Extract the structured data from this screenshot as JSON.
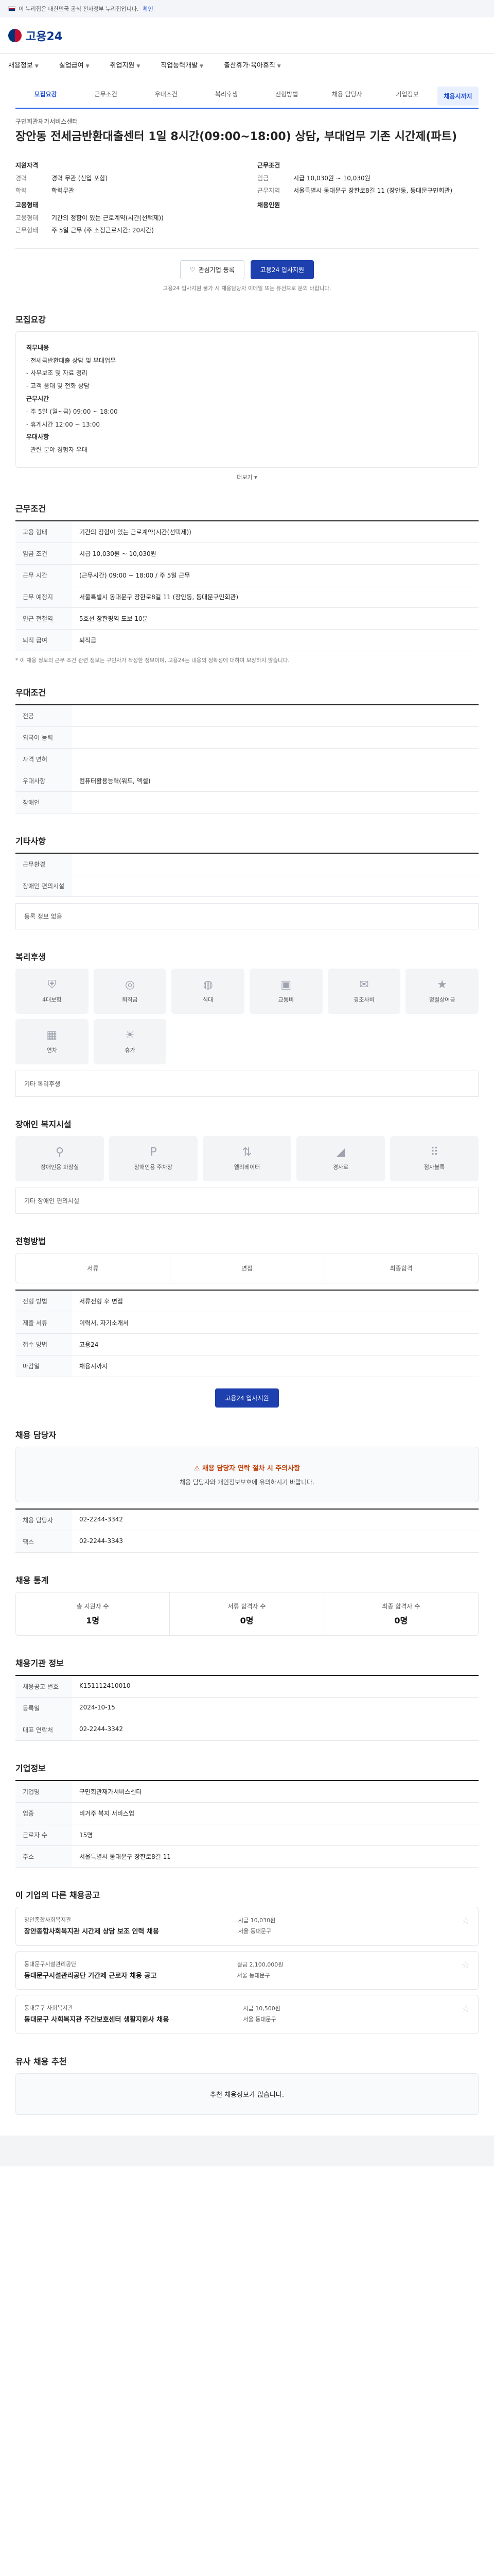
{
  "topbar": {
    "notice": "이 누리집은 대한민국 공식 전자정부 누리집입니다.",
    "link": "확인"
  },
  "header": {
    "logo": "고용24"
  },
  "nav": [
    {
      "label": "채용정보"
    },
    {
      "label": "실업급여"
    },
    {
      "label": "취업지원"
    },
    {
      "label": "직업능력개발"
    },
    {
      "label": "출산휴가·육아휴직"
    }
  ],
  "tabs": [
    {
      "label": "모집요강",
      "active": true
    },
    {
      "label": "근무조건"
    },
    {
      "label": "우대조건"
    },
    {
      "label": "복리후생"
    },
    {
      "label": "전형방법"
    },
    {
      "label": "채용 담당자"
    },
    {
      "label": "기업정보"
    }
  ],
  "apply_tag": "채용시까지",
  "company": "구민회관재가서비스센터",
  "title": "장안동 전세금반환대출센터 1일 8시간(09:00~18:00) 상담, 부대업무 기존 시간제(파트)",
  "summary": {
    "left_title": "지원자격",
    "left": [
      {
        "k": "경력",
        "v": "경력 무관 (신입 포함)"
      },
      {
        "k": "학력",
        "v": "학력무관"
      }
    ],
    "left2_title": "고용형태",
    "left2": [
      {
        "k": "고용형태",
        "v": "기간의 정함이 있는 근로계약(시간(선택제))"
      },
      {
        "k": "근무형태",
        "v": "주 5일 근무 (주 소정근로시간: 20시간)"
      }
    ],
    "right_title": "근무조건",
    "right": [
      {
        "k": "임금",
        "v": "시급 10,030원 ~ 10,030원"
      },
      {
        "k": "근무지역",
        "v": "서울특별시 동대문구 장한로8길 11 (장안동, 동대문구민회관)"
      }
    ],
    "right2_title": "채용인원",
    "right2": [
      {
        "k": "",
        "v": ""
      }
    ]
  },
  "actions": {
    "scrap": "관심기업 등록",
    "apply": "고용24 입사지원"
  },
  "notice_small": "고용24 입사지원 불가 시 채용담당자 이메일 또는 유선으로 문의 바랍니다.",
  "sections": {
    "recruit": "모집요강",
    "recruit_body": [
      "직무내용",
      "- 전세금반환대출 상담 및 부대업무",
      "- 사무보조 및 자료 정리",
      "- 고객 응대 및 전화 상담",
      "근무시간",
      "- 주 5일 (월~금) 09:00 ~ 18:00",
      "- 휴게시간 12:00 ~ 13:00",
      "우대사항",
      "- 관련 분야 경험자 우대"
    ],
    "more": "더보기",
    "conditions": "근무조건",
    "conditions_rows": [
      {
        "k": "고용 형태",
        "v": "기간의 정함이 있는 근로계약(시간(선택제))"
      },
      {
        "k": "임금 조건",
        "v": "시급 10,030원 ~ 10,030원"
      },
      {
        "k": "근무 시간",
        "v": "(근무시간) 09:00 ~ 18:00 / 주 5일 근무"
      },
      {
        "k": "근무 예정지",
        "v": "서울특별시 동대문구 장한로8길 11 (장안동, 동대문구민회관)"
      },
      {
        "k": "인근 전철역",
        "v": "5호선 장한평역 도보 10분"
      },
      {
        "k": "퇴직 급여",
        "v": "퇴직금"
      }
    ],
    "conditions_note": "* 이 채용 정보의 근무 조건 관련 정보는 구인자가 작성한 정보이며, 고용24는 내용의 정확성에 대하여 보장하지 않습니다.",
    "preference": "우대조건",
    "preference_rows": [
      {
        "k": "전공",
        "v": ""
      },
      {
        "k": "외국어 능력",
        "v": ""
      },
      {
        "k": "자격 면허",
        "v": ""
      },
      {
        "k": "우대사항",
        "v": "컴퓨터활용능력(워드, 엑셀)"
      },
      {
        "k": "장애인",
        "v": ""
      }
    ],
    "other": "기타사항",
    "other_rows": [
      {
        "k": "근무환경",
        "v": ""
      },
      {
        "k": "장애인 편의시설",
        "v": ""
      }
    ],
    "other_empty": "등록 정보 없음",
    "welfare": "복리후생",
    "welfare_items": [
      "4대보험",
      "퇴직금",
      "식대",
      "교통비",
      "경조사비",
      "명절상여금",
      "연차",
      "휴가"
    ],
    "welfare_empty": "기타 복리후생",
    "disability": "장애인 복지시설",
    "disability_items": [
      "장애인용 화장실",
      "장애인용 주차장",
      "엘리베이터",
      "경사로",
      "점자블록"
    ],
    "disability_empty": "기타 장애인 편의시설",
    "selection": "전형방법",
    "selection_rows": [
      {
        "k": "전형 방법",
        "v": "서류전형 후 면접"
      },
      {
        "k": "제출 서류",
        "v": "이력서, 자기소개서"
      },
      {
        "k": "접수 방법",
        "v": "고용24"
      },
      {
        "k": "마감일",
        "v": "채용시까지"
      }
    ],
    "steps": [
      "서류",
      "면접",
      "최종합격"
    ],
    "apply_box_btn": "고용24 입사지원",
    "manager": "채용 담당자",
    "manager_warn": "채용 담당자 연락 절차 시 주의사항",
    "manager_text": "채용 담당자와 개인정보보호에 유의하시기 바랍니다.",
    "manager_rows": [
      {
        "k": "채용 담당자",
        "v": "02-2244-3342"
      },
      {
        "k": "팩스",
        "v": "02-2244-3343"
      }
    ],
    "stats": "채용 통계",
    "stats_items": [
      {
        "label": "총 지원자 수",
        "value": "1명"
      },
      {
        "label": "서류 합격자 수",
        "value": "0명"
      },
      {
        "label": "최종 합격자 수",
        "value": "0명"
      }
    ],
    "job_info": "채용기관 정보",
    "job_info_rows": [
      {
        "k": "채용공고 번호",
        "v": "K151112410010"
      },
      {
        "k": "등록일",
        "v": "2024-10-15"
      },
      {
        "k": "대표 연락처",
        "v": "02-2244-3342"
      }
    ],
    "company_info": "기업정보",
    "company_rows": [
      {
        "k": "기업명",
        "v": "구민회관재가서비스센터"
      },
      {
        "k": "업종",
        "v": "비거주 복지 서비스업"
      },
      {
        "k": "근로자 수",
        "v": "15명"
      },
      {
        "k": "주소",
        "v": "서울특별시 동대문구 장한로8길 11"
      }
    ],
    "related": "이 기업의 다른 채용공고",
    "related_jobs": [
      {
        "company": "장안종합사회복지관",
        "title": "장안종합사회복지관 시간제 상담 보조 인력 채용",
        "wage": "시급 10,030원",
        "region": "서울 동대문구"
      },
      {
        "company": "동대문구시설관리공단",
        "title": "동대문구시설관리공단 기간제 근로자 채용 공고",
        "wage": "월급 2,100,000원",
        "region": "서울 동대문구"
      },
      {
        "company": "동대문구 사회복지관",
        "title": "동대문구 사회복지관 주간보호센터 생활지원사 채용",
        "wage": "시급 10,500원",
        "region": "서울 동대문구"
      }
    ],
    "recommend": "유사 채용 추천",
    "recommend_empty": "추천 채용정보가 없습니다."
  }
}
